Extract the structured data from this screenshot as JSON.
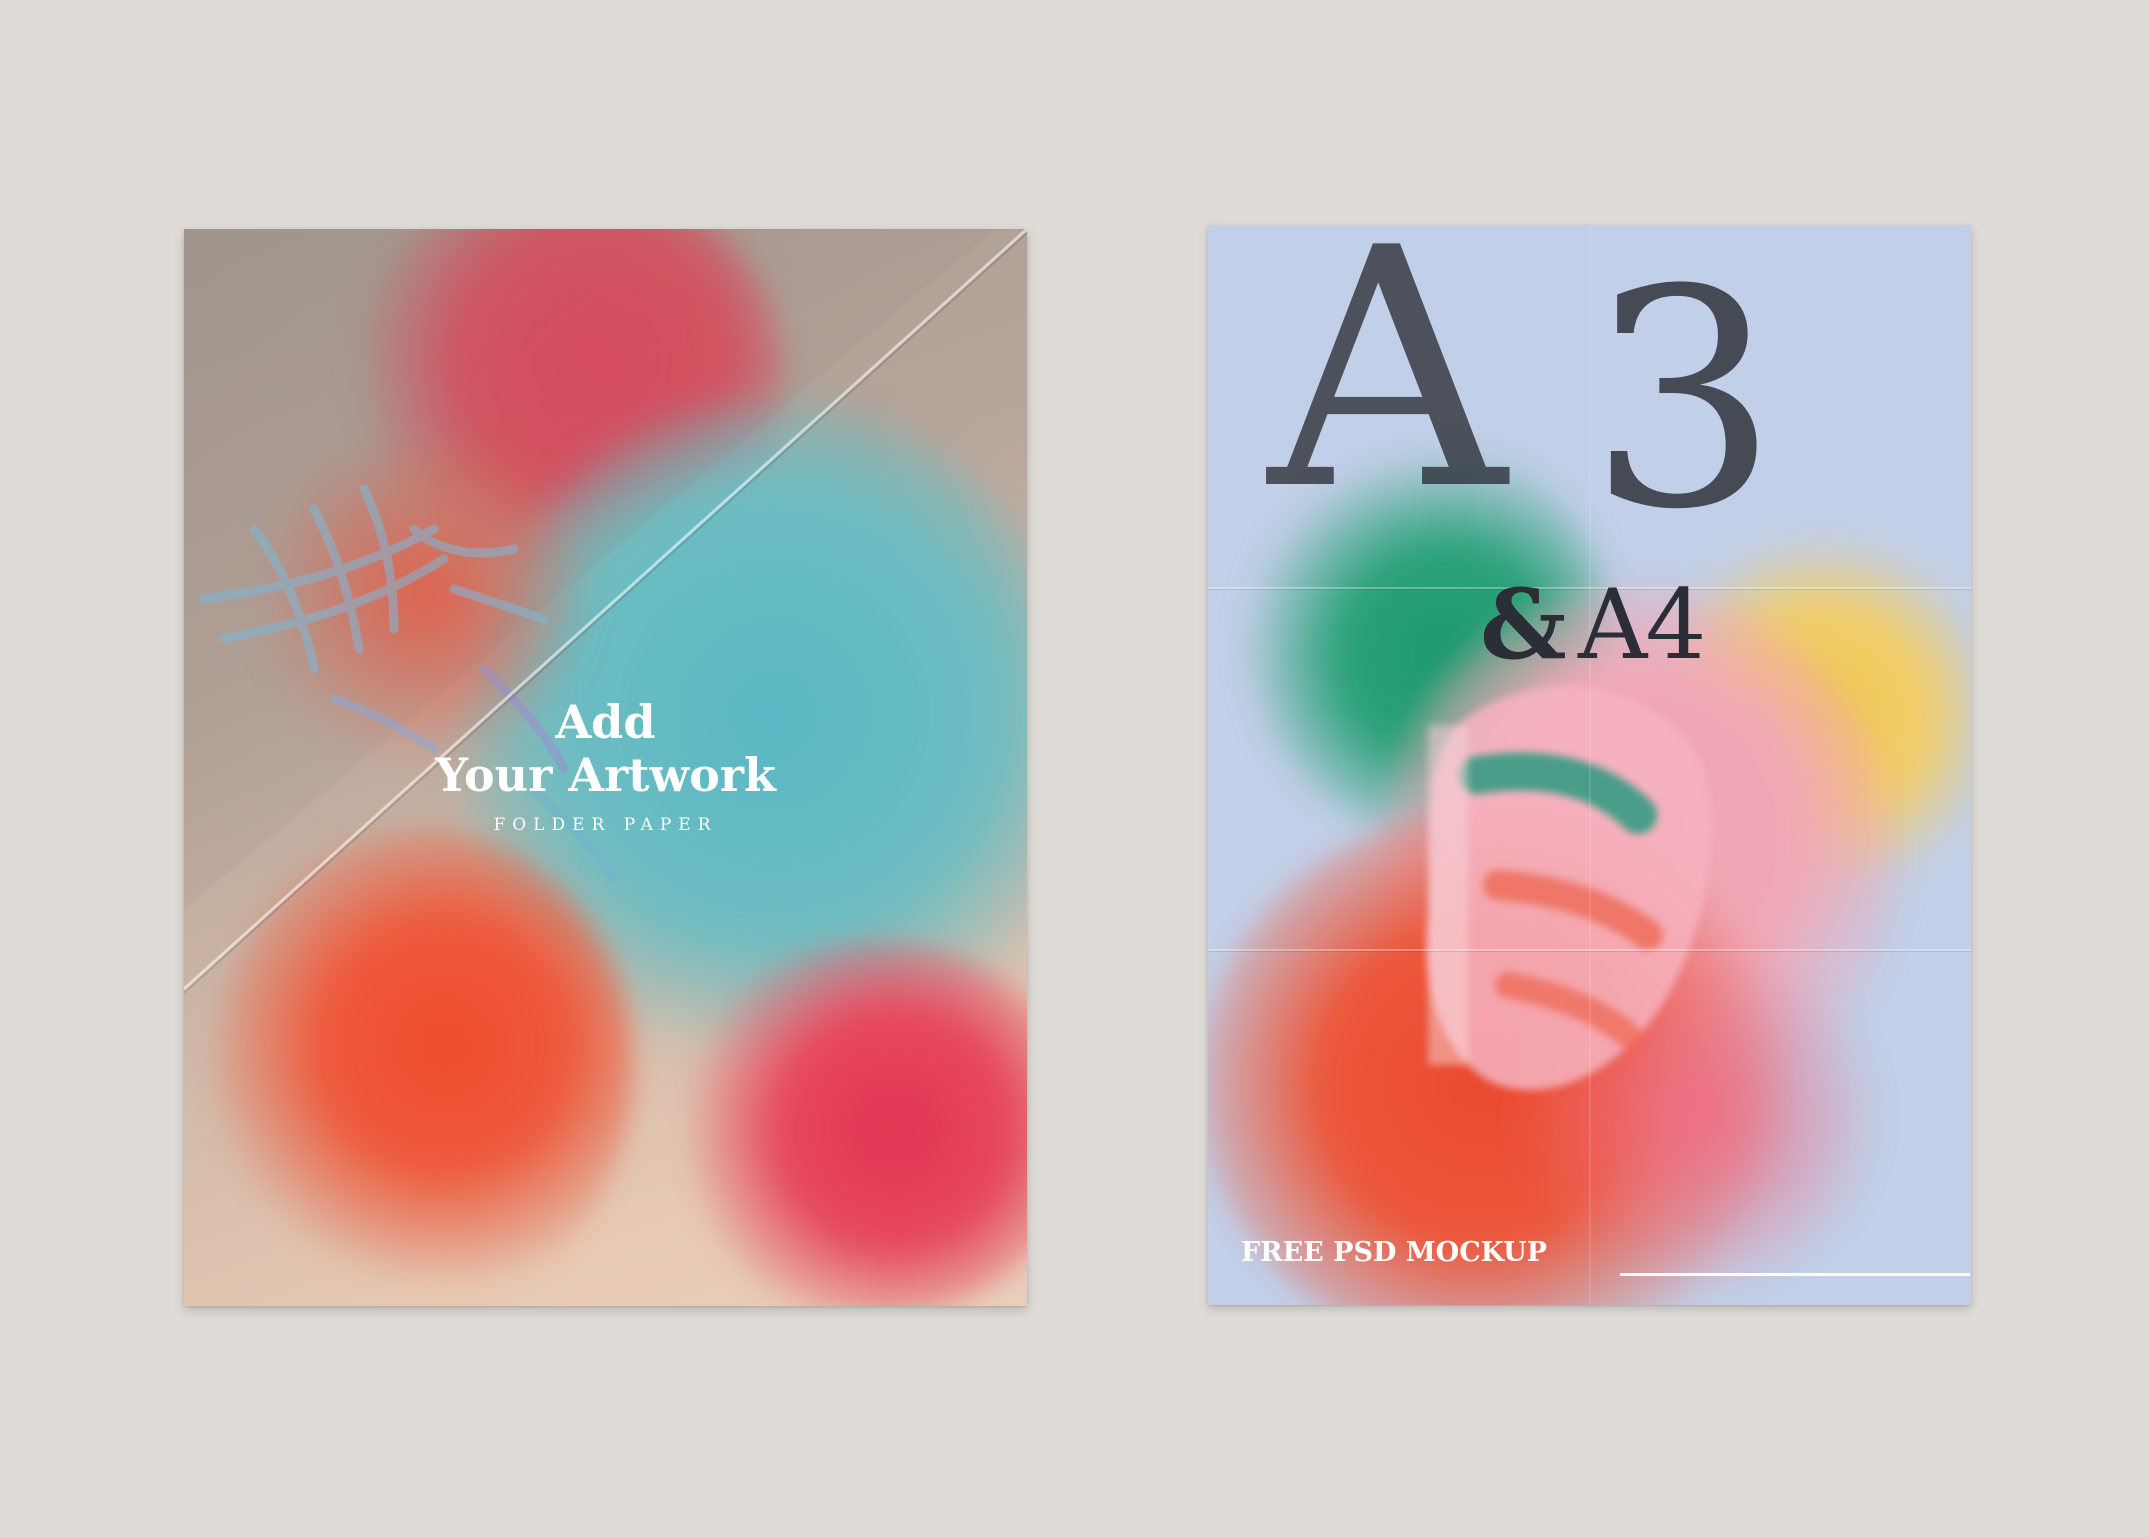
{
  "scene": {
    "background_color": "#dfdbd7"
  },
  "left_poster": {
    "title_line_1": "Add",
    "title_line_2": "Your Artwork",
    "subtitle": "FOLDER PAPER",
    "palette": [
      "#58b8c4",
      "#e43f58",
      "#ee4b2c",
      "#e23453",
      "#b7a59a"
    ]
  },
  "right_poster": {
    "headline_letter": "A",
    "headline_number": "3",
    "ampersand": "&",
    "secondary": "A4",
    "footer": "FREE PSD MOCKUP",
    "palette": [
      "#c2cfe8",
      "#1d9a6e",
      "#f0c750",
      "#f1a3b2",
      "#ea4a2f"
    ]
  }
}
